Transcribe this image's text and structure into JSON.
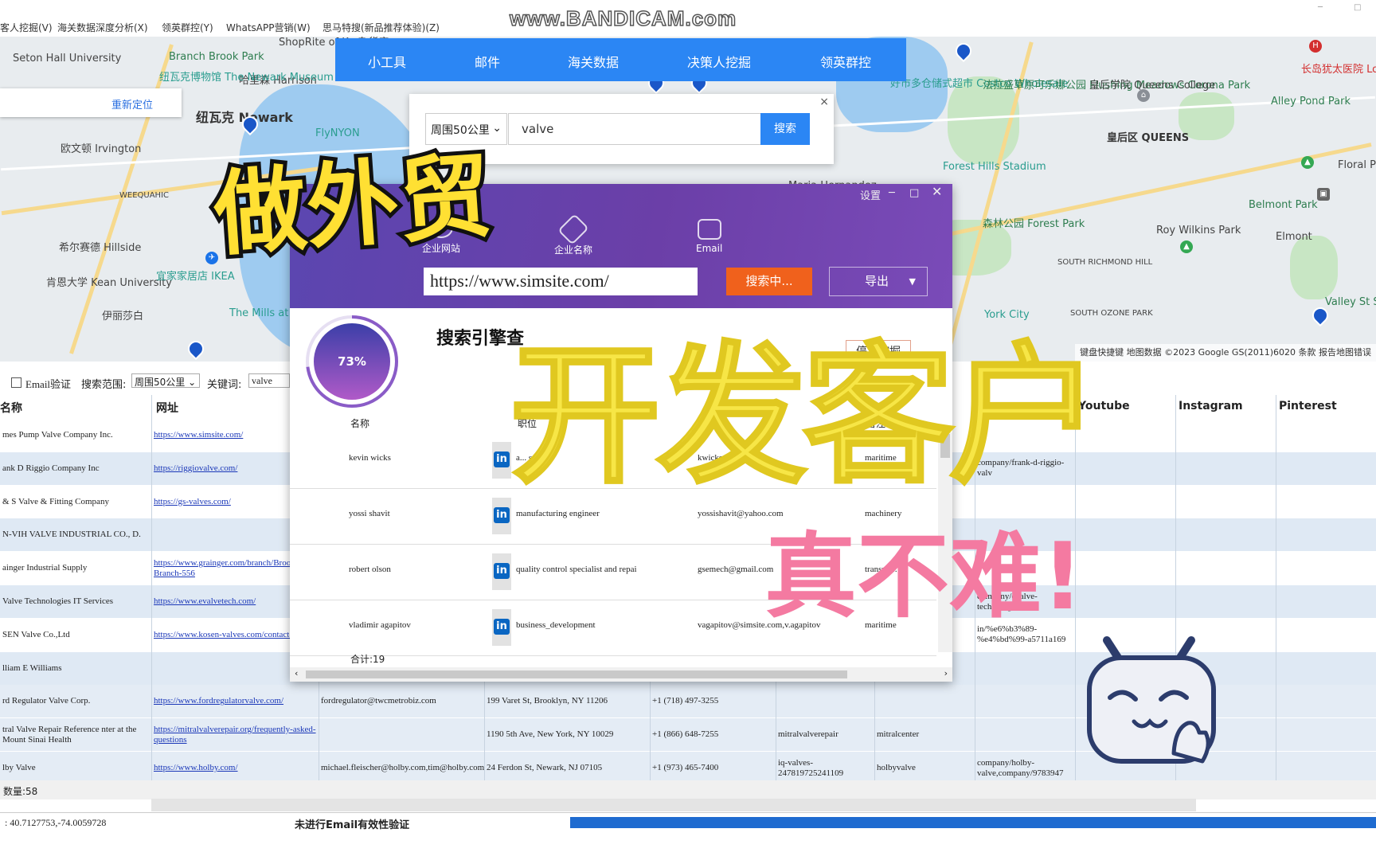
{
  "menubar": {
    "items": [
      "客人挖掘(V)",
      "海关数据深度分析(X)",
      "领英群控(Y)",
      "WhatsAPP营销(W)",
      "思马特搜(新品推荐体验)(Z)"
    ]
  },
  "watermark": "www.BANDICAM.com",
  "map": {
    "relocate": "重新定位",
    "places": [
      "Seton Hall University",
      "Branch Brook Park",
      "ShopRite of Ke 杂货店",
      "哈里森 Harrison",
      "纽瓦克博物馆 The Newark Museum of Art",
      "纽瓦克 Newark",
      "欧文顿 Irvington",
      "WEEQUAHIC",
      "希尔赛德 Hillside",
      "肯恩大学 Kean University",
      "宜家家居店 IKEA",
      "伊丽莎白",
      "The Mills at Jersey Gar",
      "FlyNYON",
      "好市多仓储式超市 Costco Wholesale",
      "法拉盛草原可乐娜公园 Flushing Meadows Corona Park",
      "皇后学院 Queens College",
      "Alley Pond Park",
      "皇后区 QUEENS",
      "Forest Hills Stadium",
      "森林公园 Forest Park",
      "Maria Hernandez",
      "Belmont Park",
      "Floral Park",
      "Roy Wilkins Park",
      "Elmont",
      "SOUTH RICHMOND HILL",
      "SOUTH OZONE PARK",
      "York City",
      "Valley St State",
      "长岛犹太医院 Long Island Jewish Med"
    ],
    "footer": "键盘快捷键  地图数据 ©2023 Google GS(2011)6020  条款  报告地图错误"
  },
  "bluenav": {
    "items": [
      "小工具",
      "邮件",
      "海关数据",
      "决策人挖掘",
      "领英群控"
    ]
  },
  "search": {
    "radius": "周围50公里",
    "keyword": "valve",
    "button": "搜索",
    "close": "×"
  },
  "filter": {
    "email_verify": "Email验证",
    "scope_label": "搜索范围:",
    "scope_value": "周围50公里",
    "keyword_label": "关键词:",
    "keyword_value": "valve"
  },
  "grid": {
    "headers": {
      "name": "名称",
      "url": "网址",
      "youtube": "Youtube",
      "instagram": "Instagram",
      "pinterest": "Pinterest"
    },
    "rows": [
      {
        "name": "mes Pump Valve Company Inc.",
        "url": "https://www.simsite.com/",
        "email": "",
        "addr": "",
        "phone": "",
        "c1": "",
        "c2": "",
        "c3": ""
      },
      {
        "name": "ank D Riggio Company Inc",
        "url": "https://riggiovalve.com/",
        "email": "",
        "addr": "",
        "phone": "",
        "c1": "",
        "c2": "",
        "c3": "company/frank-d-riggio-valv"
      },
      {
        "name": "& S Valve & Fitting Company",
        "url": "https://gs-valves.com/",
        "email": "",
        "addr": "",
        "phone": "",
        "c1": "",
        "c2": "",
        "c3": ""
      },
      {
        "name": "N-VIH VALVE INDUSTRIAL CO., D.",
        "url": "",
        "email": "",
        "addr": "",
        "phone": "",
        "c1": "",
        "c2": "",
        "c3": ""
      },
      {
        "name": "ainger Industrial Supply",
        "url": "https://www.grainger.com/branch/Brooklyn-Branch-556",
        "email": "",
        "addr": "",
        "phone": "",
        "c1": "",
        "c2": "",
        "c3": ""
      },
      {
        "name": "Valve Technologies IT Services",
        "url": "https://www.evalvetech.com/",
        "email": "",
        "addr": "",
        "phone": "",
        "c1": "",
        "c2": "",
        "c3": "company/evalve-technologies"
      },
      {
        "name": "SEN Valve Co.,Ltd",
        "url": "https://www.kosen-valves.com/contact-us",
        "email": "",
        "addr": "",
        "phone": "",
        "c1": "",
        "c2": "",
        "c3": "in/%e6%b3%89-%e4%bd%99-a5711a169"
      },
      {
        "name": "lliam E Williams",
        "url": "",
        "email": "",
        "addr": "",
        "phone": "",
        "c1": "",
        "c2": "",
        "c3": ""
      },
      {
        "name": "rd Regulator Valve Corp.",
        "url": "https://www.fordregulatorvalve.com/",
        "email": "fordregulator@twcmetrobiz.com",
        "addr": "199 Varet St, Brooklyn, NY 11206",
        "phone": "+1 (718) 497-3255",
        "c1": "",
        "c2": "",
        "c3": ""
      },
      {
        "name": "tral Valve Repair Reference nter at the Mount Sinai Health",
        "url": "https://mitralvalverepair.org/frequently-asked-questions",
        "email": "",
        "addr": "1190 5th Ave, New York, NY 10029",
        "phone": "+1 (866) 648-7255",
        "c1": "mitralvalverepair",
        "c2": "mitralcenter",
        "c3": ""
      },
      {
        "name": "lby Valve",
        "url": "https://www.holby.com/",
        "email": "michael.fleischer@holby.com,tim@holby.com,pinko@holby.com,tlenti",
        "addr": "24 Ferdon St, Newark, NJ 07105",
        "phone": "+1 (973) 465-7400",
        "c1": "iq-valves-247819725241109",
        "c2": "holbyvalve",
        "c3": "company/holby-valve,company/9783947"
      }
    ],
    "total": "数量:58"
  },
  "status": {
    "coords": ": 40.7127753,-74.0059728",
    "verify": "未进行Email有效性验证",
    "progress": 1.0
  },
  "popup": {
    "settings": "设置",
    "tabs": [
      "企业网站",
      "企业名称",
      "Email"
    ],
    "url": "https://www.simsite.com/",
    "searching": "搜索中...",
    "export": "导出",
    "percent": 0.73,
    "percent_label": "73%",
    "engine_title": "搜索引擎查",
    "stop": "停止挖掘",
    "contact_headers": [
      "名称",
      "职位",
      "Email",
      "备注"
    ],
    "contacts": [
      {
        "name": "kevin wicks",
        "title": "a... s",
        "email": "kwicks@...revi...",
        "note": "maritime"
      },
      {
        "name": "yossi shavit",
        "title": "manufacturing engineer",
        "email": "yossishavit@yahoo.com",
        "note": "machinery"
      },
      {
        "name": "robert olson",
        "title": "quality control specialist and repai",
        "email": "gsemech@gmail.com",
        "note": "transpo..."
      },
      {
        "name": "vladimir agapitov",
        "title": "business_development",
        "email": "vagapitov@simsite.com,v.agapitov",
        "note": "maritime"
      }
    ],
    "total": "合计:19"
  },
  "overlays": {
    "line1": "做外贸",
    "line2": "开发客户",
    "line3": "真不难!"
  },
  "colors": {
    "nav_blue": "#2b86f4",
    "popup_purple": "#5b46b0",
    "orange": "#f0611c",
    "sticker_yellow": "#ffe033",
    "sticker_pink": "#f47aa1"
  }
}
